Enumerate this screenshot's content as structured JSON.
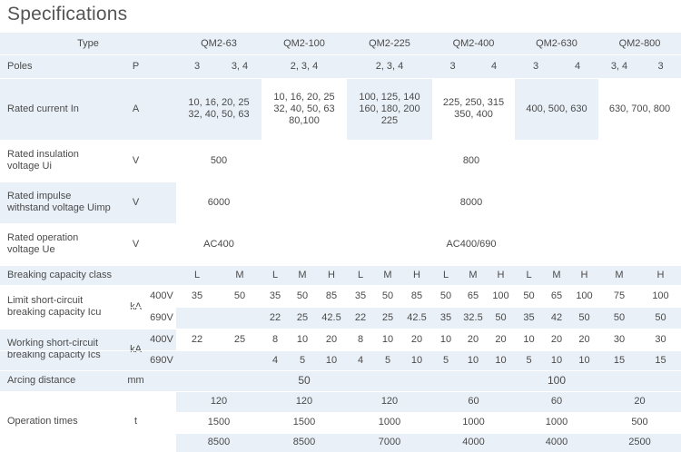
{
  "title": "Specifications",
  "header": {
    "type_label": "Type",
    "models": [
      "QM2-63",
      "QM2-100",
      "QM2-225",
      "QM2-400",
      "QM2-630",
      "QM2-800"
    ]
  },
  "rows": {
    "poles": {
      "label": "Poles",
      "unit": "P",
      "values": [
        "3",
        "3, 4",
        "2, 3, 4",
        "2, 3, 4",
        "3",
        "4",
        "3",
        "4",
        "3, 4",
        "3"
      ]
    },
    "rated_current": {
      "label": "Rated current In",
      "unit": "A",
      "values": [
        "10, 16, 20, 25\n32, 40, 50, 63",
        "10, 16, 20, 25\n32, 40, 50, 63\n80,100",
        "100, 125, 140\n160, 180, 200\n225",
        "225, 250, 315\n350, 400",
        "400, 500, 630",
        "630, 700, 800"
      ]
    },
    "insulation_voltage": {
      "label": "Rated insulation\nvoltage Ui",
      "unit": "V",
      "values": [
        "500",
        "800"
      ]
    },
    "impulse_voltage": {
      "label": "Rated impulse\nwithstand voltage Uimp",
      "unit": "V",
      "values": [
        "6000",
        "8000"
      ]
    },
    "operation_voltage": {
      "label": "Rated operation\nvoltage Ue",
      "unit": "V",
      "values": [
        "AC400",
        "AC400/690"
      ]
    },
    "breaking_class": {
      "label": "Breaking capacity class",
      "values": [
        "L",
        "M",
        "L",
        "M",
        "H",
        "L",
        "M",
        "H",
        "L",
        "M",
        "H",
        "L",
        "M",
        "H",
        "M",
        "H"
      ]
    },
    "icu": {
      "label": "Limit short-circuit\nbreaking capacity Icu",
      "unit": "kA",
      "v400_label": "400V",
      "v690_label": "690V",
      "v400": [
        "35",
        "50",
        "35",
        "50",
        "85",
        "35",
        "50",
        "85",
        "50",
        "65",
        "100",
        "50",
        "65",
        "100",
        "75",
        "100"
      ],
      "v690": [
        "22",
        "25",
        "42.5",
        "22",
        "25",
        "42.5",
        "35",
        "32.5",
        "50",
        "35",
        "42",
        "50",
        "50",
        "50"
      ]
    },
    "ics": {
      "label": "Working short-circuit\nbreaking capacity Ics",
      "unit": "kA",
      "v400_label": "400V",
      "v690_label": "690V",
      "v400": [
        "22",
        "25",
        "8",
        "10",
        "20",
        "8",
        "10",
        "20",
        "10",
        "20",
        "20",
        "10",
        "20",
        "20",
        "30",
        "30"
      ],
      "v690": [
        "4",
        "5",
        "10",
        "4",
        "5",
        "10",
        "5",
        "10",
        "10",
        "5",
        "10",
        "10",
        "15",
        "15"
      ]
    },
    "arcing": {
      "label": "Arcing distance",
      "unit": "mm",
      "values": [
        "50",
        "100"
      ]
    },
    "operation_times": {
      "label": "Operation times",
      "unit": "t",
      "r1": [
        "120",
        "120",
        "120",
        "60",
        "60",
        "20"
      ],
      "r2": [
        "1500",
        "1500",
        "1000",
        "1000",
        "1000",
        "500"
      ],
      "r3": [
        "8500",
        "8500",
        "7000",
        "4000",
        "4000",
        "2500"
      ]
    }
  }
}
